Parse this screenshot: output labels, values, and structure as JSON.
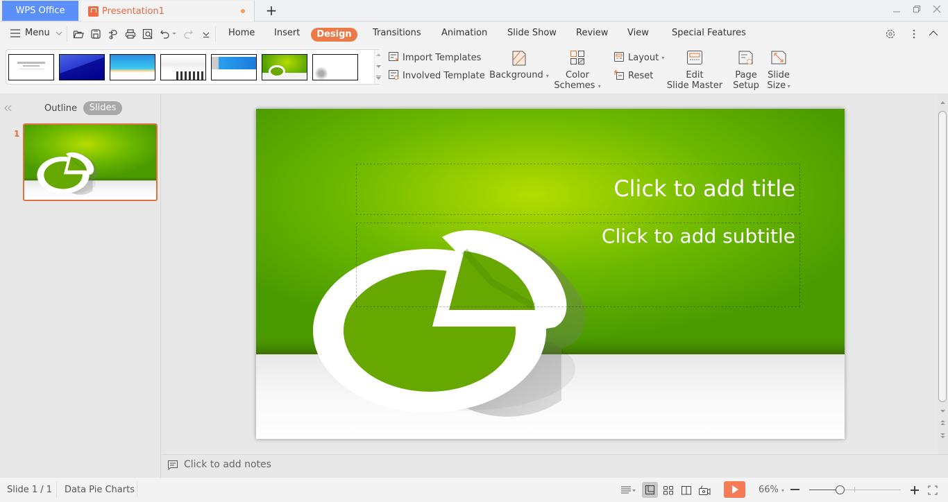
{
  "titlebar": {
    "app_tab": "WPS Office",
    "doc_tab": "Presentation1",
    "unsaved_indicator": true,
    "new_tab": "+"
  },
  "menubar": {
    "menu_label": "Menu",
    "tabs": [
      "Home",
      "Insert",
      "Design",
      "Transitions",
      "Animation",
      "Slide Show",
      "Review",
      "View",
      "Special Features"
    ],
    "active_tab": "Design",
    "quick_access": [
      "open-icon",
      "save-icon",
      "export-icon",
      "print-icon",
      "print-preview-icon",
      "undo-icon",
      "redo-icon",
      "customize-icon"
    ]
  },
  "ribbon": {
    "templates": [
      "Blank master",
      "Blue diagonal",
      "Blue wave",
      "Silhouettes",
      "Blue banner",
      "Data Pie Charts",
      "Gears"
    ],
    "import_templates": "Import Templates",
    "involved_template": "Involved Template",
    "background": "Background",
    "color_schemes_1": "Color",
    "color_schemes_2": "Schemes",
    "layout": "Layout",
    "reset": "Reset",
    "edit_master_1": "Edit",
    "edit_master_2": "Slide Master",
    "page_setup_1": "Page",
    "page_setup_2": "Setup",
    "slide_size_1": "Slide",
    "slide_size_2": "Size"
  },
  "leftpanel": {
    "outline_tab": "Outline",
    "slides_tab": "Slides",
    "slide_number": "1"
  },
  "slide": {
    "title_placeholder": "Click to add title",
    "subtitle_placeholder": "Click to add subtitle"
  },
  "notes": {
    "placeholder": "Click to add notes"
  },
  "statusbar": {
    "slide_counter": "Slide 1 / 1",
    "theme_name": "Data Pie Charts",
    "zoom": "66%",
    "zoom_fraction": 0.33
  },
  "colors": {
    "accent": "#ec7a48",
    "wps_blue": "#5b8ff9",
    "slide_green": "#66a800"
  }
}
